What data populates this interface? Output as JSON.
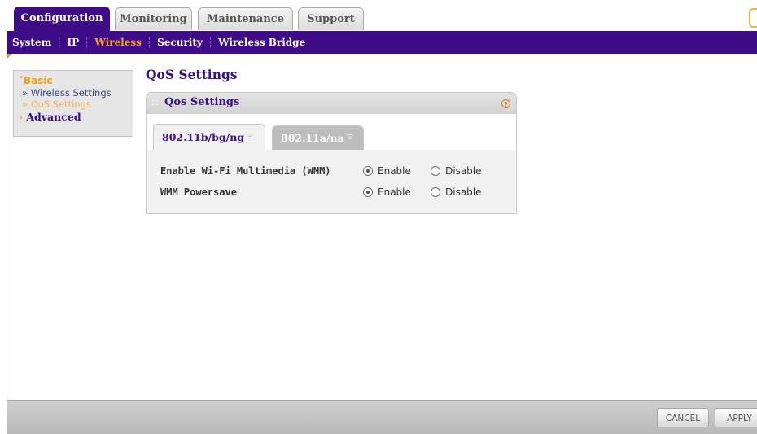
{
  "top_tabs": {
    "configuration": "Configuration",
    "monitoring": "Monitoring",
    "maintenance": "Maintenance",
    "support": "Support"
  },
  "subnav": {
    "system": "System",
    "ip": "IP",
    "wireless": "Wireless",
    "security": "Security",
    "wireless_bridge": "Wireless Bridge"
  },
  "sidebar": {
    "basic": "Basic",
    "wireless_settings": "» Wireless Settings",
    "qos_settings": "» QoS Settings",
    "advanced": "Advanced"
  },
  "page": {
    "title": "QoS Settings"
  },
  "panel": {
    "title": "Qos Settings",
    "help": "?"
  },
  "inner_tabs": {
    "bgn": "802.11b/bg/ng",
    "ana": "802.11a/na"
  },
  "settings": {
    "wmm_label": "Enable Wi-Fi Multimedia (WMM)",
    "wmm_enable": "Enable",
    "wmm_disable": "Disable",
    "powersave_label": "WMM Powersave",
    "powersave_enable": "Enable",
    "powersave_disable": "Disable"
  },
  "buttons": {
    "cancel": "CANCEL",
    "apply": "APPLY"
  },
  "colors": {
    "brand_purple": "#3d0c86",
    "accent_orange": "#f39c12"
  }
}
